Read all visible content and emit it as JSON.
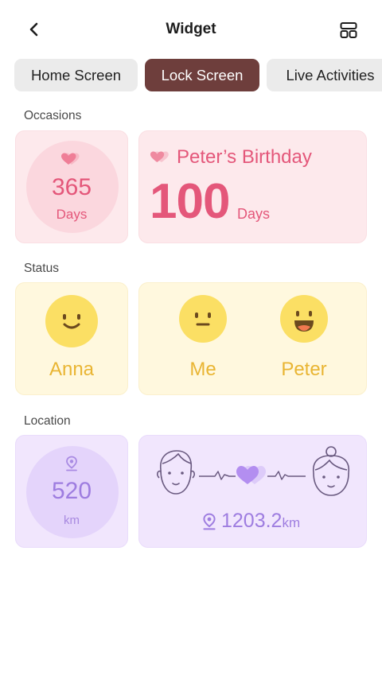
{
  "header": {
    "title": "Widget",
    "back_icon": "chevron-left-icon",
    "layout_icon": "layout-grid-icon"
  },
  "tabs": [
    {
      "label": "Home Screen",
      "selected": false
    },
    {
      "label": "Lock Screen",
      "selected": true
    },
    {
      "label": "Live Activities",
      "selected": false
    }
  ],
  "sections": {
    "occasions": {
      "label": "Occasions",
      "small": {
        "value": "365",
        "unit": "Days",
        "icon": "hearts-icon"
      },
      "large": {
        "name": "Peter’s Birthday",
        "value": "100",
        "unit": "Days",
        "icon": "hearts-icon"
      }
    },
    "status": {
      "label": "Status",
      "small": {
        "name": "Anna",
        "mood": "smile"
      },
      "large": {
        "left": {
          "name": "Me",
          "mood": "neutral"
        },
        "right": {
          "name": "Peter",
          "mood": "grin"
        }
      }
    },
    "location": {
      "label": "Location",
      "small": {
        "value": "520",
        "unit": "km",
        "icon": "location-pin-icon"
      },
      "large": {
        "value": "1203.2",
        "unit": "km",
        "icon": "location-pin-icon"
      }
    }
  },
  "colors": {
    "accent_tab": "#6e3e3c",
    "pink_text": "#e4577a",
    "yellow_text": "#e9b533",
    "purple_text": "#9e7de0"
  }
}
